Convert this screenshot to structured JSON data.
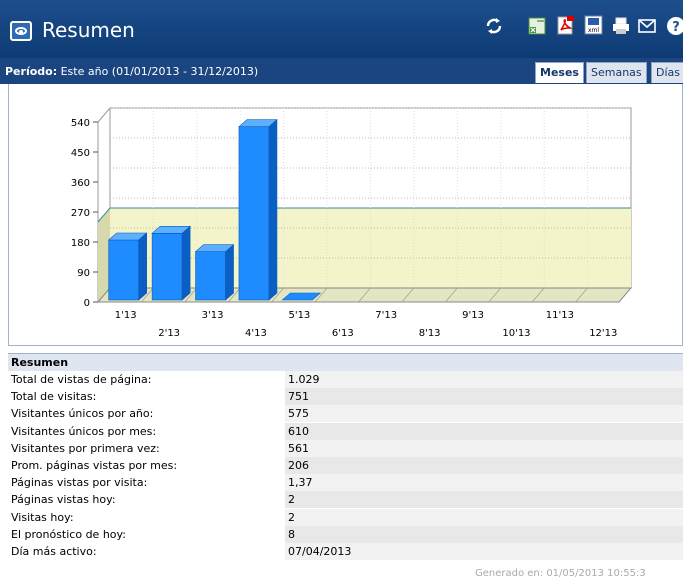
{
  "header": {
    "title": "Resumen",
    "icons": [
      "refresh-icon",
      "excel-icon",
      "pdf-icon",
      "xml-icon",
      "print-icon",
      "email-icon",
      "help-icon"
    ]
  },
  "period": {
    "label": "Período:",
    "value": "Este año (01/01/2013 - 31/12/2013)"
  },
  "tabs": [
    {
      "label": "Meses",
      "active": true
    },
    {
      "label": "Semanas",
      "active": false
    },
    {
      "label": "Días",
      "active": false
    }
  ],
  "chart_data": {
    "type": "bar",
    "categories": [
      "1'13",
      "2'13",
      "3'13",
      "4'13",
      "5'13",
      "6'13",
      "7'13",
      "8'13",
      "9'13",
      "10'13",
      "11'13",
      "12'13"
    ],
    "values": [
      180,
      200,
      145,
      520,
      0,
      0,
      0,
      0,
      0,
      0,
      0,
      0
    ],
    "ylim": [
      0,
      540
    ],
    "yticks": [
      "0",
      "90",
      "180",
      "270",
      "360",
      "450",
      "540"
    ],
    "band_value": 240,
    "bar_color": "#1e90ff",
    "band_color": "#f3f4c9",
    "grid": true
  },
  "summary": {
    "title": "Resumen",
    "rows": [
      {
        "label": "Total de vistas de página:",
        "value": "1.029"
      },
      {
        "label": "Total de visitas:",
        "value": "751"
      },
      {
        "label": "Visitantes únicos por año:",
        "value": "575"
      },
      {
        "label": "Visitantes únicos por mes:",
        "value": "610"
      },
      {
        "label": "Visitantes por primera vez:",
        "value": "561"
      },
      {
        "label": "Prom. páginas vistas por mes:",
        "value": "206"
      },
      {
        "label": "Páginas vistas por visita:",
        "value": "1,37"
      },
      {
        "label": "Páginas vistas hoy:",
        "value": "2"
      },
      {
        "label": "Visitas hoy:",
        "value": "2"
      },
      {
        "label": "El pronóstico de hoy:",
        "value": "8"
      },
      {
        "label": "Día más activo:",
        "value": "07/04/2013"
      }
    ]
  },
  "footer": "Generado en: 01/05/2013 10:55:3"
}
